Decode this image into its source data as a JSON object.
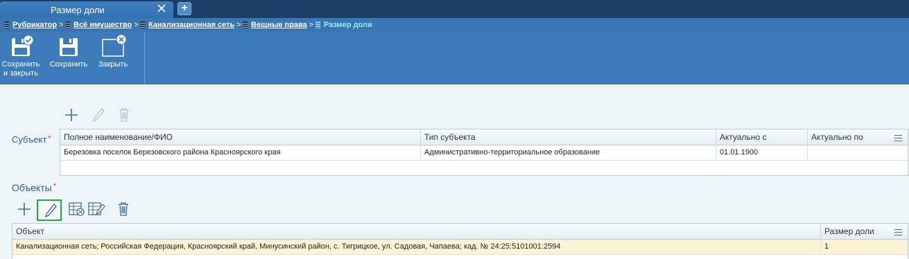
{
  "window": {
    "tab_title": "Размер доли",
    "add_tab_label": "+"
  },
  "breadcrumb": [
    {
      "label": "Рубрикатор",
      "sep": ">"
    },
    {
      "label": "Всё имущество",
      "sep": ">"
    },
    {
      "label": "Канализационная сеть",
      "sep": ">"
    },
    {
      "label": "Вещные права",
      "sep": ">"
    },
    {
      "label": "Размер доли",
      "sep": ""
    }
  ],
  "toolbar": {
    "save_close_line1": "Сохранить",
    "save_close_line2": "и закрыть",
    "save_label": "Сохранить",
    "close_label": "Закрыть"
  },
  "subject": {
    "label": "Субъект",
    "required_mark": "*",
    "columns": [
      "Полное наименование/ФИО",
      "Тип субъекта",
      "Актуально с",
      "Актуально по"
    ],
    "rows": [
      [
        "Березовка поселок Березовского района Красноярского края",
        "Административно-территориальное образование",
        "01.01.1900",
        ""
      ]
    ]
  },
  "objects": {
    "label": "Объекты",
    "required_mark": "*",
    "columns": [
      "Объект",
      "Размер доли"
    ],
    "rows": [
      [
        "Канализационная сеть; Российская Федерация, Красноярский край, Минусинский район, с. Тигрицкое, ул. Садовая, Чапаева; кад. № 24:25:5101001:2594",
        "1"
      ]
    ]
  },
  "colors": {
    "tabbar": "#1d3e66",
    "toolbar": "#3d7bbb",
    "content_bg": "#edf5f9",
    "label": "#2c5f8e",
    "required": "#e03030",
    "selected_row": "#fcf2d4",
    "active_tool_border": "#2ea043"
  }
}
